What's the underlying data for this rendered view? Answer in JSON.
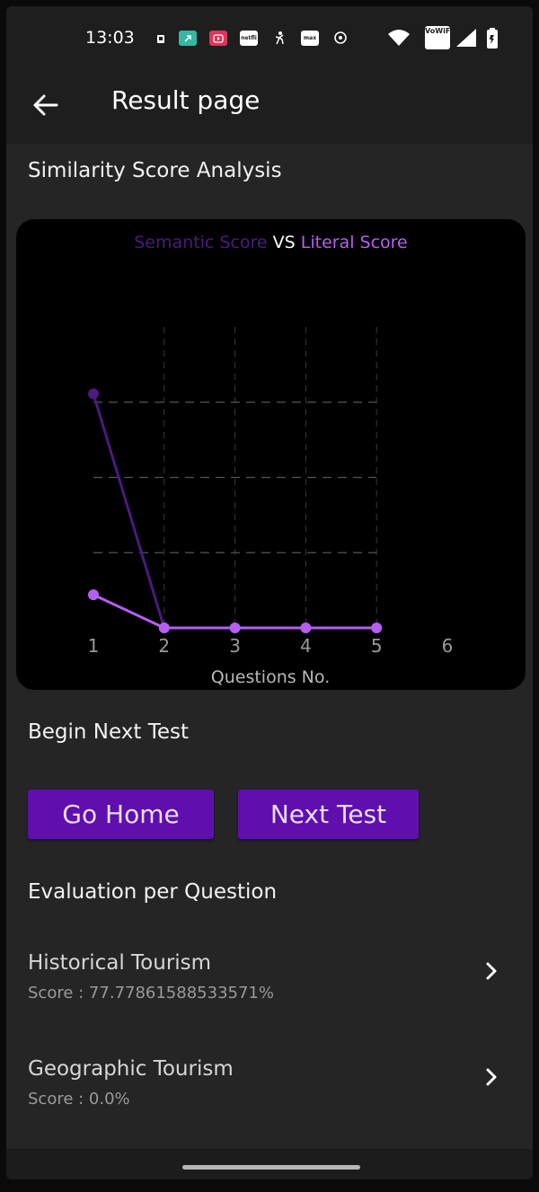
{
  "status_bar": {
    "time": "13:03",
    "notification_icons": [
      {
        "name": "sim-card-icon",
        "color": "#1e1e1e",
        "text": ""
      },
      {
        "name": "external-link-app-icon",
        "color": "#34b8a4",
        "text": ""
      },
      {
        "name": "video-app-icon",
        "color": "#e0345a",
        "text": ""
      },
      {
        "name": "netflix-app-icon",
        "color": "#ffffff",
        "text": "netfli"
      },
      {
        "name": "figure-app-icon",
        "color": "#1e1e1e",
        "text": ""
      },
      {
        "name": "max-app-icon",
        "color": "#ffffff",
        "text": "max"
      },
      {
        "name": "music-app-icon",
        "color": "#1e1e1e",
        "text": ""
      }
    ],
    "vowifi_label": "VoWiFi"
  },
  "app_bar": {
    "title": "Result page"
  },
  "sections": {
    "similarity_title": "Similarity Score Analysis",
    "next_test_title": "Begin Next Test",
    "evaluation_title": "Evaluation per Question"
  },
  "chart_data": {
    "type": "line",
    "title_parts": {
      "semantic": "Semantic Score",
      "vs": " VS ",
      "literal": "Literal Score"
    },
    "xlabel": "Questions No.",
    "ylabel": "",
    "x_ticks": [
      1,
      2,
      3,
      4,
      5,
      6
    ],
    "xlim": [
      1,
      6
    ],
    "ylim": [
      0,
      100
    ],
    "grid": true,
    "series": [
      {
        "name": "Semantic Score",
        "color": "#4c1a7e",
        "x": [
          1,
          2
        ],
        "values": [
          77.78,
          0
        ]
      },
      {
        "name": "Literal Score",
        "color": "#b75ef2",
        "x": [
          1,
          2,
          3,
          4,
          5
        ],
        "values": [
          11,
          0,
          0,
          0,
          0
        ]
      }
    ]
  },
  "buttons": {
    "go_home": "Go Home",
    "next_test": "Next Test"
  },
  "evaluations": [
    {
      "title": "Historical Tourism",
      "score": "Score : 77.77861588533571%"
    },
    {
      "title": "Geographic Tourism",
      "score": "Score : 0.0%"
    }
  ],
  "colors": {
    "accent": "#5e0fae",
    "background": "#262526",
    "card": "#000000"
  }
}
